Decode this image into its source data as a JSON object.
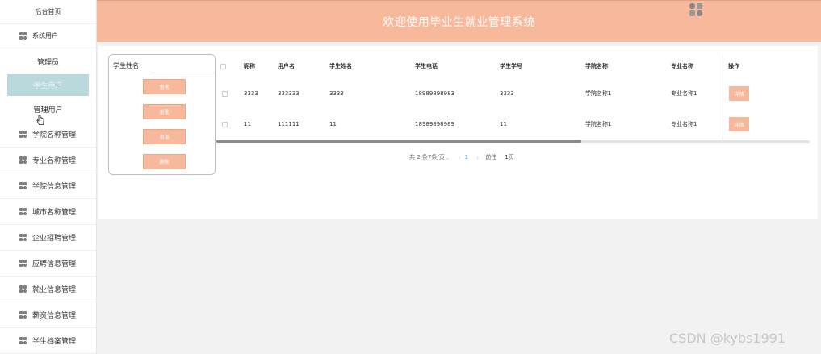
{
  "header": {
    "title": "欢迎使用毕业生就业管理系统"
  },
  "sidebar": {
    "home": "后台首页",
    "system_user": "系统用户",
    "subitems": [
      "管理员",
      "学生用户",
      "管理用户"
    ],
    "items": [
      "学院名称管理",
      "专业名称管理",
      "学院信息管理",
      "城市名称管理",
      "企业招聘管理",
      "应聘信息管理",
      "就业信息管理",
      "薪资信息管理",
      "学生档案管理"
    ]
  },
  "search": {
    "label": "学生姓名:",
    "value": "",
    "buttons": {
      "query": "查询",
      "reset": "重置",
      "add": "添加",
      "delete": "删除"
    }
  },
  "table": {
    "headers": [
      "昵称",
      "用户名",
      "学生姓名",
      "学生电话",
      "学生学号",
      "学院名称",
      "专业名称",
      "操作"
    ],
    "rows": [
      {
        "nickname": "3333",
        "username": "333333",
        "name": "3333",
        "phone": "18989898983",
        "student_no": "3333",
        "college": "学院名称1",
        "major": "专业名称1",
        "action": "详情"
      },
      {
        "nickname": "11",
        "username": "111111",
        "name": "11",
        "phone": "18989898989",
        "student_no": "11",
        "college": "学院名称1",
        "major": "专业名称1",
        "action": "详情"
      }
    ]
  },
  "pagination": {
    "total": "共 2 条",
    "page_size": "7条/页",
    "current": "1",
    "goto_label": "前往",
    "goto_value": "1",
    "page_suffix": "页"
  },
  "watermark": "CSDN @kybs1991",
  "colors": {
    "accent": "#f7b89b",
    "active_menu": "#b9d9dc",
    "page_link": "#409eff"
  }
}
